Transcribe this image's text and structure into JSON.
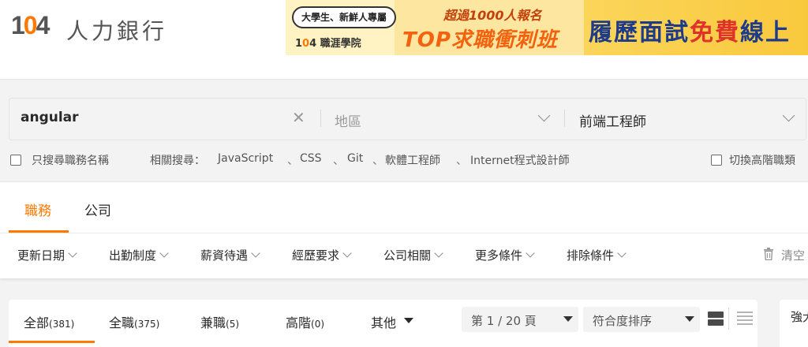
{
  "header": {
    "logo_number_a": "1",
    "logo_number_o": "0",
    "logo_number_b": "4",
    "logo_text": "人力銀行",
    "banner": {
      "tag": "大學生、新鮮人專屬",
      "school_num_a": "1",
      "school_num_o": "0",
      "school_num_b": "4",
      "school_text": "職涯學院",
      "over_text": "超過1000人報名",
      "main_text": "TOP求職衝刺班",
      "right_text_a": "履歷面試",
      "right_text_hl": "免費",
      "right_text_b": "線上"
    }
  },
  "search": {
    "keyword": "angular",
    "clear_glyph": "✕",
    "area_placeholder": "地區",
    "category_value": "前端工程師"
  },
  "options": {
    "title_only_label": "只搜尋職務名稱",
    "related_label": "相關搜尋：",
    "related": [
      "JavaScript",
      "CSS",
      "Git",
      "軟體工程師",
      "Internet程式設計師"
    ],
    "related_sep": "、",
    "advanced_label": "切換高階職類"
  },
  "tabs": {
    "jobs": "職務",
    "companies": "公司"
  },
  "filters": [
    "更新日期",
    "出勤制度",
    "薪資待遇",
    "經歷要求",
    "公司相關",
    "更多條件",
    "排除條件"
  ],
  "clear_label": "清空",
  "results": {
    "tabs": [
      {
        "label": "全部",
        "count": "(381)"
      },
      {
        "label": "全職",
        "count": "(375)"
      },
      {
        "label": "兼職",
        "count": "(5)"
      },
      {
        "label": "高階",
        "count": "(0)"
      }
    ],
    "other_label": "其他",
    "page_select": "第 1 / 20 頁",
    "sort_select": "符合度排序"
  },
  "side": {
    "text": "強大"
  },
  "colors": {
    "accent": "#ff7800",
    "text": "#292929",
    "muted": "#9a9a9a"
  }
}
